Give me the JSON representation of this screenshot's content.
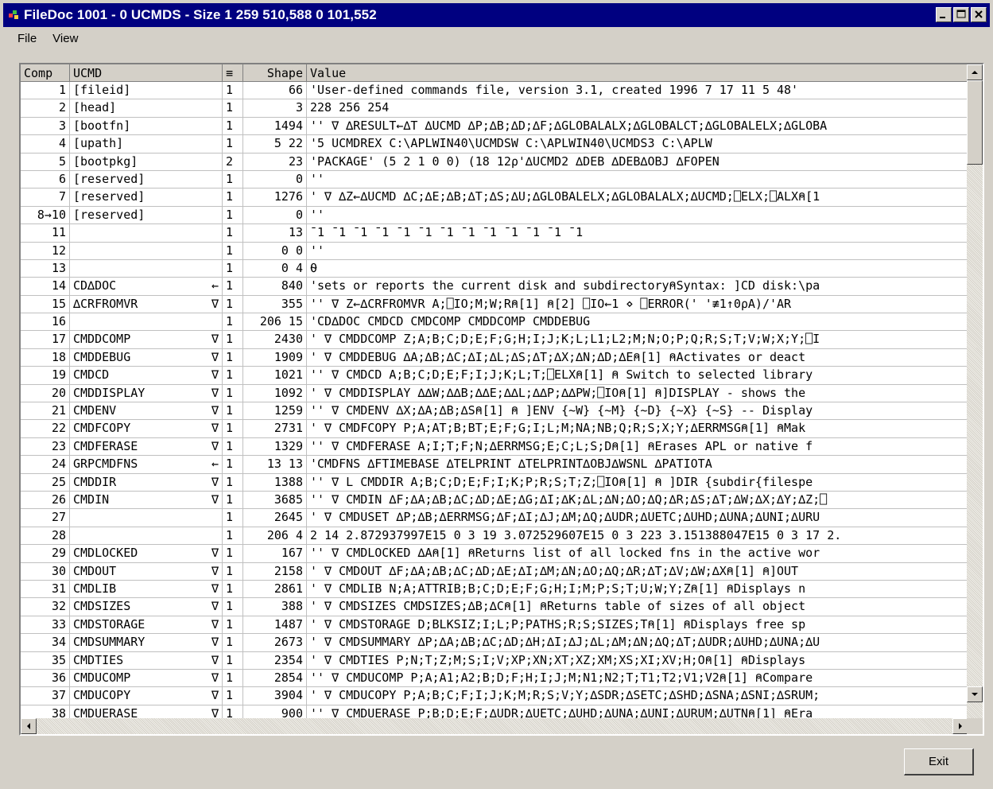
{
  "window": {
    "title": "FileDoc 1001 - 0 UCMDS - Size 1 259 510,588 0 101,552"
  },
  "menu": [
    {
      "label": "File"
    },
    {
      "label": "View"
    }
  ],
  "columns": [
    "Comp",
    "UCMD",
    "≡",
    "Shape",
    "Value"
  ],
  "rows": [
    {
      "comp": "1",
      "ucmd": "[fileid]",
      "mark": "",
      "depth": "1",
      "shape": "66",
      "value": "'User-defined commands file, version 3.1, created 1996 7 17 11 5 48'"
    },
    {
      "comp": "2",
      "ucmd": "[head]",
      "mark": "",
      "depth": "1",
      "shape": "3",
      "value": "228 256 254"
    },
    {
      "comp": "3",
      "ucmd": "[bootfn]",
      "mark": "",
      "depth": "1",
      "shape": "1494",
      "value": "''    ∇ ∆RESULT←∆T ∆UCMD ∆P;∆B;∆D;∆F;∆GLOBALALX;∆GLOBALCT;∆GLOBALELX;∆GLOBA"
    },
    {
      "comp": "4",
      "ucmd": "[upath]",
      "mark": "",
      "depth": "1",
      "shape": "5 22",
      "value": "'5 UCMDREX              C:\\APLWIN40\\UCMDSW     C:\\APLWIN40\\UCMDS3     C:\\APLW"
    },
    {
      "comp": "5",
      "ucmd": "[bootpkg]",
      "mark": "",
      "depth": "2",
      "shape": "23",
      "value": "'PACKAGE' (5 2 1 0 0) (18 12⍴'∆UCMD2         ∆DEB          ∆DEB∆OBJ      ∆FOPEN"
    },
    {
      "comp": "6",
      "ucmd": "[reserved]",
      "mark": "",
      "depth": "1",
      "shape": "0",
      "value": "''"
    },
    {
      "comp": "7",
      "ucmd": "[reserved]",
      "mark": "",
      "depth": "1",
      "shape": "1276",
      "value": "'    ∇ ∆Z←∆UCMD ∆C;∆E;∆B;∆T;∆S;∆U;∆GLOBALELX;∆GLOBALALX;∆UCMD;⎕ELX;⎕ALX⍝[1"
    },
    {
      "comp": "8→10",
      "ucmd": "[reserved]",
      "mark": "",
      "depth": "1",
      "shape": "0",
      "value": "''"
    },
    {
      "comp": "11",
      "ucmd": "",
      "mark": "",
      "depth": "1",
      "shape": "13",
      "value": "¯1 ¯1 ¯1 ¯1 ¯1 ¯1 ¯1 ¯1 ¯1 ¯1 ¯1 ¯1 ¯1"
    },
    {
      "comp": "12",
      "ucmd": "",
      "mark": "",
      "depth": "1",
      "shape": "0 0",
      "value": "''"
    },
    {
      "comp": "13",
      "ucmd": "",
      "mark": "",
      "depth": "1",
      "shape": "0 4",
      "value": "⍬"
    },
    {
      "comp": "14",
      "ucmd": "CD∆DOC",
      "mark": "←",
      "depth": "1",
      "shape": "840",
      "value": "'sets or reports the current disk and subdirectory⍝Syntax:   ]CD  disk:\\pa"
    },
    {
      "comp": "15",
      "ucmd": "∆CRFROMVR",
      "mark": "∇",
      "depth": "1",
      "shape": "355",
      "value": "''   ∇ Z←∆CRFROMVR A;⎕IO;M;W;R⍝[1]     ⍝[2]     ⎕IO←1 ⋄ ⎕ERROR(' '≢1↑0⍴A)/'AR"
    },
    {
      "comp": "16",
      "ucmd": "",
      "mark": "",
      "depth": "1",
      "shape": "206 15",
      "value": "'CD∆DOC         CMDCD          CMDCOMP        CMDDCOMP       CMDDEBUG"
    },
    {
      "comp": "17",
      "ucmd": "CMDDCOMP",
      "mark": "∇",
      "depth": "1",
      "shape": "2430",
      "value": "'    ∇ CMDDCOMP Z;A;B;C;D;E;F;G;H;I;J;K;L;L1;L2;M;N;O;P;Q;R;S;T;V;W;X;Y;⎕I"
    },
    {
      "comp": "18",
      "ucmd": "CMDDEBUG",
      "mark": "∇",
      "depth": "1",
      "shape": "1909",
      "value": "'    ∇ CMDDEBUG ∆A;∆B;∆C;∆I;∆L;∆S;∆T;∆X;∆N;∆D;∆E⍝[1]   ⍝Activates or deact"
    },
    {
      "comp": "19",
      "ucmd": "CMDCD",
      "mark": "∇",
      "depth": "1",
      "shape": "1021",
      "value": "''   ∇ CMDCD A;B;C;D;E;F;I;J;K;L;T;⎕ELX⍝[1]   ⍝ Switch to selected library"
    },
    {
      "comp": "20",
      "ucmd": "CMDDISPLAY",
      "mark": "∇",
      "depth": "1",
      "shape": "1092",
      "value": "'    ∇ CMDDISPLAY ∆∆W;∆∆B;∆∆E;∆∆L;∆∆P;∆∆PW;⎕IO⍝[1]   ⍝]DISPLAY - shows the"
    },
    {
      "comp": "21",
      "ucmd": "CMDENV",
      "mark": "∇",
      "depth": "1",
      "shape": "1259",
      "value": "''   ∇ CMDENV ∆X;∆A;∆B;∆S⍝[1]   ⍝ ]ENV {~W} {~M} {~D} {~X} {~S} -- Display"
    },
    {
      "comp": "22",
      "ucmd": "CMDFCOPY",
      "mark": "∇",
      "depth": "1",
      "shape": "2731",
      "value": "'    ∇ CMDFCOPY P;A;AT;B;BT;E;F;G;I;L;M;NA;NB;Q;R;S;X;Y;∆ERRMSG⍝[1]   ⍝Mak"
    },
    {
      "comp": "23",
      "ucmd": "CMDFERASE",
      "mark": "∇",
      "depth": "1",
      "shape": "1329",
      "value": "''   ∇ CMDFERASE A;I;T;F;N;∆ERRMSG;E;C;L;S;D⍝[1]   ⍝Erases APL or native f"
    },
    {
      "comp": "24",
      "ucmd": "GRPCMDFNS",
      "mark": "←",
      "depth": "1",
      "shape": "13 13",
      "value": "'CMDFNS        ∆FTIMEBASE    ∆TELPRINT     ∆TELPRINT∆OBJ∆WSNL       ∆PATIOTA"
    },
    {
      "comp": "25",
      "ucmd": "CMDDIR",
      "mark": "∇",
      "depth": "1",
      "shape": "1388",
      "value": "''   ∇ L CMDDIR A;B;C;D;E;F;I;K;P;R;S;T;Z;⎕IO⍝[1]   ⍝ ]DIR {subdir{filespe"
    },
    {
      "comp": "26",
      "ucmd": "CMDIN",
      "mark": "∇",
      "depth": "1",
      "shape": "3685",
      "value": "''   ∇ CMDIN ∆F;∆A;∆B;∆C;∆D;∆E;∆G;∆I;∆K;∆L;∆N;∆O;∆Q;∆R;∆S;∆T;∆W;∆X;∆Y;∆Z;⎕"
    },
    {
      "comp": "27",
      "ucmd": "",
      "mark": "",
      "depth": "1",
      "shape": "2645",
      "value": "'    ∇ CMDUSET ∆P;∆B;∆ERRMSG;∆F;∆I;∆J;∆M;∆Q;∆UDR;∆UETC;∆UHD;∆UNA;∆UNI;∆URU"
    },
    {
      "comp": "28",
      "ucmd": "",
      "mark": "",
      "depth": "1",
      "shape": "206 4",
      "value": "2 14 2.872937997E15 0 3 19 3.072529607E15 0 3 223 3.151388047E15 0 3 17 2."
    },
    {
      "comp": "29",
      "ucmd": "CMDLOCKED",
      "mark": "∇",
      "depth": "1",
      "shape": "167",
      "value": "''   ∇ CMDLOCKED ∆A⍝[1]   ⍝Returns list of all locked fns in the active wor"
    },
    {
      "comp": "30",
      "ucmd": "CMDOUT",
      "mark": "∇",
      "depth": "1",
      "shape": "2158",
      "value": "'    ∇ CMDOUT ∆F;∆A;∆B;∆C;∆D;∆E;∆I;∆M;∆N;∆O;∆Q;∆R;∆T;∆V;∆W;∆X⍝[1]   ⍝]OUT"
    },
    {
      "comp": "31",
      "ucmd": "CMDLIB",
      "mark": "∇",
      "depth": "1",
      "shape": "2861",
      "value": "'    ∇ CMDLIB N;A;ATTRIB;B;C;D;E;F;G;H;I;M;P;S;T;U;W;Y;Z⍝[1]   ⍝Displays n"
    },
    {
      "comp": "32",
      "ucmd": "CMDSIZES",
      "mark": "∇",
      "depth": "1",
      "shape": "388",
      "value": "'    ∇ CMDSIZES CMDSIZES;∆B;∆C⍝[1]   ⍝Returns table of sizes of all object"
    },
    {
      "comp": "33",
      "ucmd": "CMDSTORAGE",
      "mark": "∇",
      "depth": "1",
      "shape": "1487",
      "value": "'    ∇ CMDSTORAGE D;BLKSIZ;I;L;P;PATHS;R;S;SIZES;T⍝[1]   ⍝Displays free sp"
    },
    {
      "comp": "34",
      "ucmd": "CMDSUMMARY",
      "mark": "∇",
      "depth": "1",
      "shape": "2673",
      "value": "'    ∇ CMDSUMMARY ∆P;∆A;∆B;∆C;∆D;∆H;∆I;∆J;∆L;∆M;∆N;∆Q;∆T;∆UDR;∆UHD;∆UNA;∆U"
    },
    {
      "comp": "35",
      "ucmd": "CMDTIES",
      "mark": "∇",
      "depth": "1",
      "shape": "2354",
      "value": "'    ∇ CMDTIES P;N;T;Z;M;S;I;V;XP;XN;XT;XZ;XM;XS;XI;XV;H;O⍝[1]   ⍝Displays"
    },
    {
      "comp": "36",
      "ucmd": "CMDUCOMP",
      "mark": "∇",
      "depth": "1",
      "shape": "2854",
      "value": "''   ∇ CMDUCOMP P;A;A1;A2;B;D;F;H;I;J;M;N1;N2;T;T1;T2;V1;V2⍝[1]   ⍝Compare"
    },
    {
      "comp": "37",
      "ucmd": "CMDUCOPY",
      "mark": "∇",
      "depth": "1",
      "shape": "3904",
      "value": "'    ∇ CMDUCOPY P;A;B;C;F;I;J;K;M;R;S;V;Y;∆SDR;∆SETC;∆SHD;∆SNA;∆SNI;∆SRUM;"
    },
    {
      "comp": "38",
      "ucmd": "CMDUERASE",
      "mark": "∇",
      "depth": "1",
      "shape": "900",
      "value": "''   ∇ CMDUERASE P;B;D;E;F;∆UDR;∆UETC;∆UHD;∆UNA;∆UNI;∆URUM;∆UTN⍝[1]   ⍝Era"
    }
  ],
  "buttons": {
    "exit": "Exit"
  },
  "colors": {
    "titlebar": "#000080",
    "face": "#d4d0c8"
  }
}
